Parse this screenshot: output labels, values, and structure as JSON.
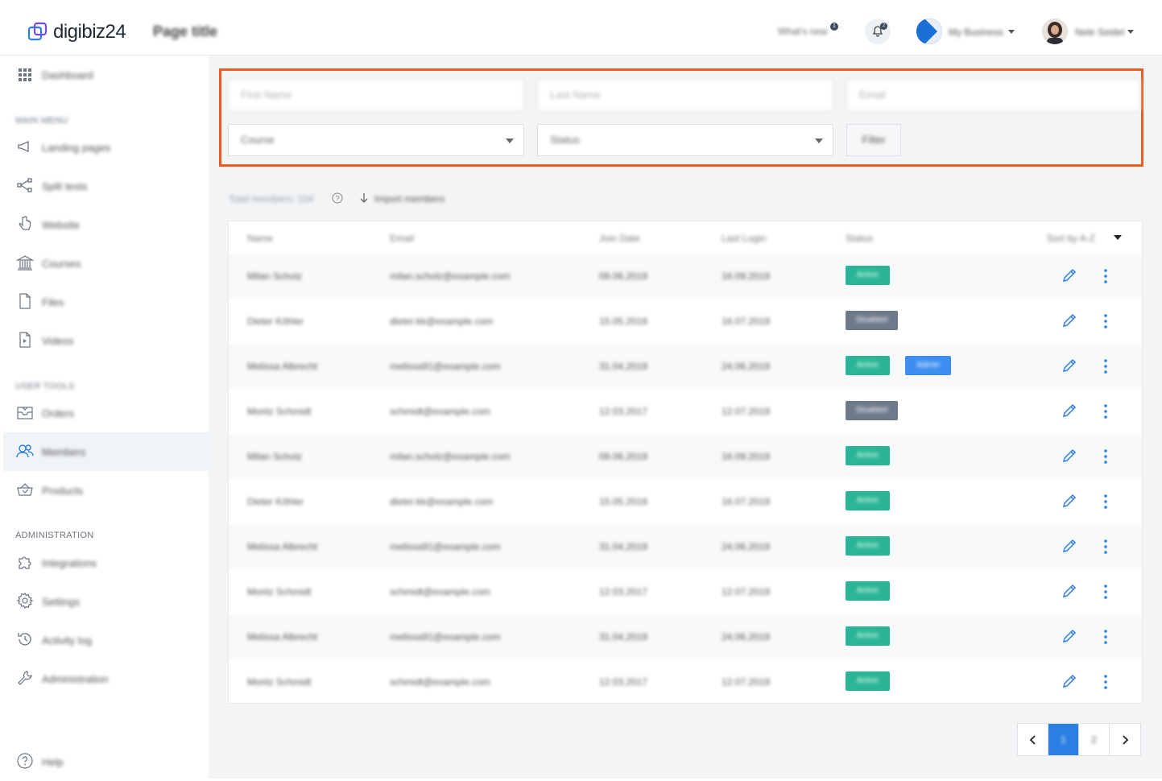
{
  "header": {
    "logo_text": "digibiz24",
    "page_title": "Page title",
    "whats_new": "What's new",
    "whats_new_badge": "1",
    "notification_badge": "2",
    "business_label": "My Business",
    "user_label": "Nele Seidel"
  },
  "sidebar": {
    "dashboard": "Dashboard",
    "main_menu_label": "MAIN MENU",
    "items_main": [
      {
        "label": "Landing pages",
        "icon": "megaphone-icon"
      },
      {
        "label": "Split tests",
        "icon": "share-nodes-icon"
      },
      {
        "label": "Website",
        "icon": "pointer-hand-icon"
      },
      {
        "label": "Courses",
        "icon": "institution-icon"
      },
      {
        "label": "Files",
        "icon": "file-icon"
      },
      {
        "label": "Videos",
        "icon": "video-file-icon"
      }
    ],
    "users_label": "USER TOOLS",
    "items_users": [
      {
        "label": "Orders",
        "icon": "inbox-icon"
      },
      {
        "label": "Members",
        "icon": "users-icon"
      },
      {
        "label": "Products",
        "icon": "basket-icon"
      }
    ],
    "admin_label": "ADMINISTRATION",
    "items_admin": [
      {
        "label": "Integrations",
        "icon": "puzzle-icon"
      },
      {
        "label": "Settings",
        "icon": "gear-icon"
      },
      {
        "label": "Activity log",
        "icon": "history-icon"
      },
      {
        "label": "Administration",
        "icon": "wrench-icon"
      }
    ],
    "help": "Help"
  },
  "filters": {
    "first_name_placeholder": "First Name",
    "last_name_placeholder": "Last Name",
    "email_placeholder": "Email",
    "course_value": "Course",
    "status_value": "Status",
    "filter_button": "Filter"
  },
  "summary": {
    "total_members": "Total members: 104",
    "import_label": "Import members"
  },
  "table": {
    "columns": {
      "name": "Name",
      "email": "Email",
      "join_date": "Join Date",
      "last_login": "Last Login",
      "status": "Status",
      "sort": "Sort by A-Z"
    },
    "rows": [
      {
        "name": "Milan Scholz",
        "email": "milan.scholz@example.com",
        "join": "09.06.2019",
        "login": "16.09.2019",
        "status": "Active",
        "status_kind": "active",
        "extra": ""
      },
      {
        "name": "Dieter Köhler",
        "email": "dieter.kk@example.com",
        "join": "15.05.2016",
        "login": "16.07.2019",
        "status": "Disabled",
        "status_kind": "disabled",
        "extra": ""
      },
      {
        "name": "Melissa Albrecht",
        "email": "melissa91@example.com",
        "join": "31.04.2019",
        "login": "24.06.2019",
        "status": "Active",
        "status_kind": "active",
        "extra": "Admin"
      },
      {
        "name": "Moritz Schmidt",
        "email": "schmidt@example.com",
        "join": "12.03.2017",
        "login": "12.07.2019",
        "status": "Disabled",
        "status_kind": "disabled",
        "extra": ""
      },
      {
        "name": "Milan Scholz",
        "email": "milan.scholz@example.com",
        "join": "09.06.2019",
        "login": "16.09.2019",
        "status": "Active",
        "status_kind": "active",
        "extra": ""
      },
      {
        "name": "Dieter Köhler",
        "email": "dieter.kk@example.com",
        "join": "15.05.2016",
        "login": "16.07.2019",
        "status": "Active",
        "status_kind": "active",
        "extra": ""
      },
      {
        "name": "Melissa Albrecht",
        "email": "melissa91@example.com",
        "join": "31.04.2019",
        "login": "24.06.2019",
        "status": "Active",
        "status_kind": "active",
        "extra": ""
      },
      {
        "name": "Moritz Schmidt",
        "email": "schmidt@example.com",
        "join": "12.03.2017",
        "login": "12.07.2019",
        "status": "Active",
        "status_kind": "active",
        "extra": ""
      },
      {
        "name": "Melissa Albrecht",
        "email": "melissa91@example.com",
        "join": "31.04.2019",
        "login": "24.06.2019",
        "status": "Active",
        "status_kind": "active",
        "extra": ""
      },
      {
        "name": "Moritz Schmidt",
        "email": "schmidt@example.com",
        "join": "12.03.2017",
        "login": "12.07.2019",
        "status": "Active",
        "status_kind": "active",
        "extra": ""
      }
    ]
  },
  "pagination": {
    "current": "1",
    "next_page": "2"
  },
  "colors": {
    "accent": "#2b7fe3",
    "active_badge": "#2bb596",
    "disabled_badge": "#6c7a8c",
    "admin_badge": "#3d8ef0",
    "highlight_border": "#ee5a24",
    "edit_icon": "#2b7fe3"
  }
}
